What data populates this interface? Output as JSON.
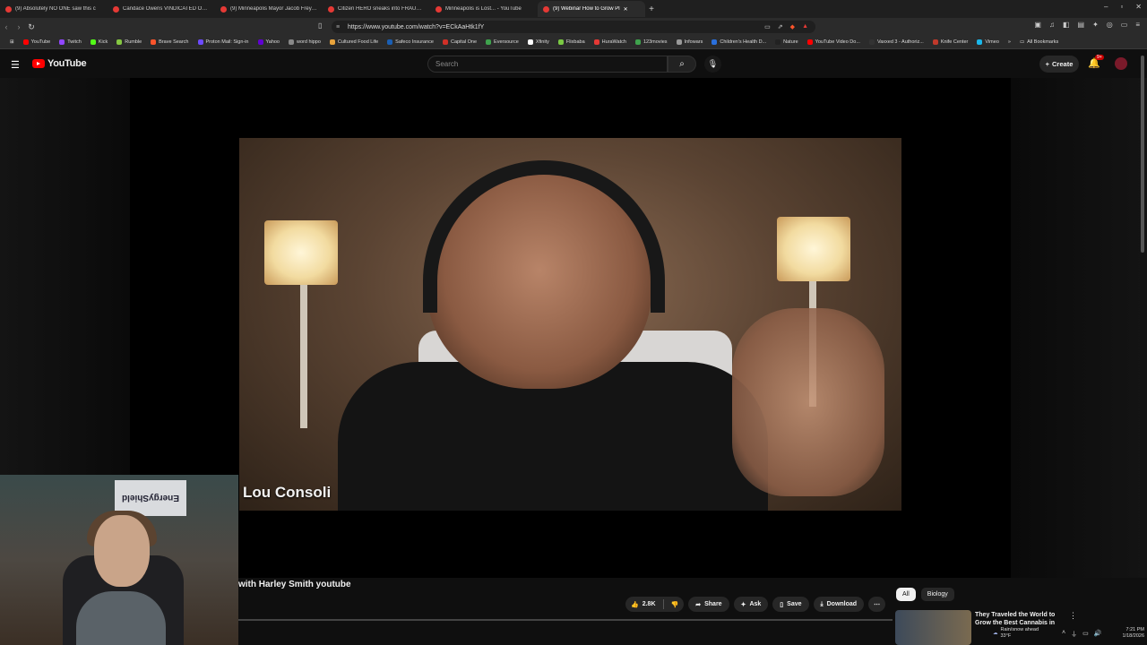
{
  "tabs": [
    {
      "label": "(9) Absolutely NO ONE saw this c",
      "active": false
    },
    {
      "label": "Candace Owens VINDICATED Over F",
      "active": false
    },
    {
      "label": "(9) Minneapolis Mayor Jacob Frey sa",
      "active": false
    },
    {
      "label": "Citizen HERO sneaks into FRAUD CE",
      "active": false
    },
    {
      "label": "Minneapolis is Lost... - YouTube",
      "active": false
    },
    {
      "label": "(9) Webinar How to Grow Pl",
      "active": true
    }
  ],
  "address": {
    "url": "https://www.youtube.com/watch?v=ECkAaHtk1fY"
  },
  "bookmarks": [
    {
      "label": "YouTube",
      "color": "#ff0000"
    },
    {
      "label": "Twitch",
      "color": "#9146ff"
    },
    {
      "label": "Kick",
      "color": "#53fc18"
    },
    {
      "label": "Rumble",
      "color": "#85c742"
    },
    {
      "label": "Brave Search",
      "color": "#fb542b"
    },
    {
      "label": "Proton Mail: Sign-in",
      "color": "#6d4aff"
    },
    {
      "label": "Yahoo",
      "color": "#6001d2"
    },
    {
      "label": "word hippo",
      "color": "#888888"
    },
    {
      "label": "Cultured Food Life",
      "color": "#e8a33c"
    },
    {
      "label": "Safeco Insurance",
      "color": "#1a5fb4"
    },
    {
      "label": "Capital One",
      "color": "#d03027"
    },
    {
      "label": "Eversource",
      "color": "#3fa34d"
    },
    {
      "label": "Xfinity",
      "color": "#ffffff"
    },
    {
      "label": "Flixbaba",
      "color": "#7ac943"
    },
    {
      "label": "HuraWatch",
      "color": "#e53935"
    },
    {
      "label": "123movies",
      "color": "#3fa34d"
    },
    {
      "label": "Infowars",
      "color": "#999999"
    },
    {
      "label": "Children's Health D...",
      "color": "#2a6fdb"
    },
    {
      "label": "Nature",
      "color": "#222222"
    },
    {
      "label": "YouTube Video Do...",
      "color": "#ff0000"
    },
    {
      "label": "Vaxxed 3 - Authoriz...",
      "color": "#333333"
    },
    {
      "label": "Knife Center",
      "color": "#c0392b"
    },
    {
      "label": "Vimeo",
      "color": "#1ab7ea"
    }
  ],
  "bookmarks_all": "All Bookmarks",
  "youtube": {
    "logo_text": "YouTube",
    "search_placeholder": "Search",
    "create_label": "Create",
    "notif_count": "9+"
  },
  "video": {
    "speaker_name": "Lou Consoli",
    "webcam_banner": "EnergyShield",
    "title": "with Harley Smith youtube"
  },
  "actions": {
    "likes": "2.8K",
    "share": "Share",
    "ask": "Ask",
    "save": "Save",
    "download": "Download"
  },
  "chips": [
    "All",
    "Biology"
  ],
  "recommendation": {
    "title": "They Traveled the World to Grow the Best Cannabis in"
  },
  "taskbar": {
    "weather_line1": "Rain/snow ahead",
    "weather_line2": "33°F",
    "time": "7:21 PM",
    "date": "1/18/2026"
  }
}
